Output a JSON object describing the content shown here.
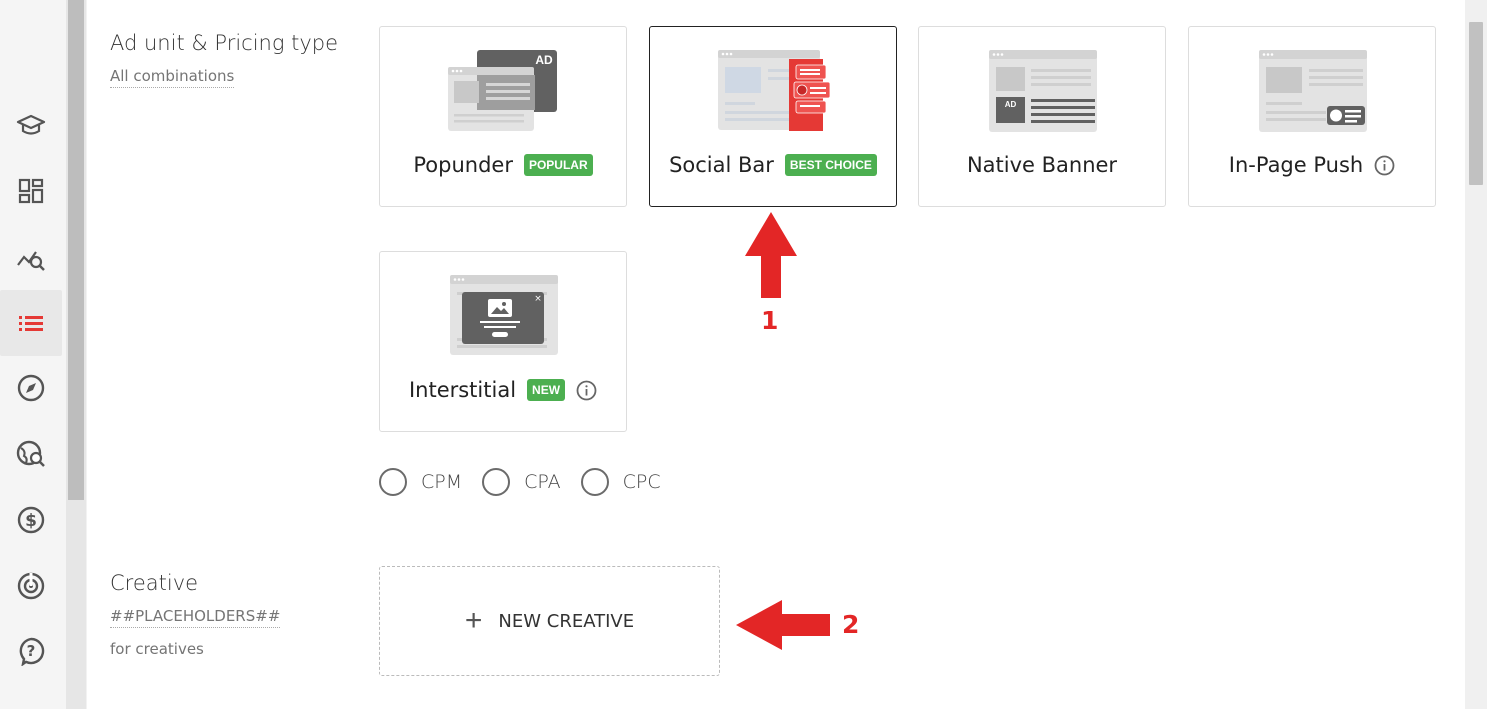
{
  "sidebar": {
    "items": [
      {
        "icon": "graduation-cap-icon"
      },
      {
        "icon": "dashboard-icon"
      },
      {
        "icon": "analytics-search-icon"
      },
      {
        "icon": "list-icon",
        "active": true
      },
      {
        "icon": "compass-icon"
      },
      {
        "icon": "globe-search-icon"
      },
      {
        "icon": "dollar-icon"
      },
      {
        "icon": "radar-icon"
      },
      {
        "icon": "help-icon"
      }
    ],
    "active_color": "#e53935"
  },
  "ad_unit": {
    "title": "Ad unit & Pricing type",
    "subtitle": "All combinations",
    "cards": [
      {
        "title": "Popunder",
        "badge": "POPULAR"
      },
      {
        "title": "Social Bar",
        "badge": "BEST CHOICE",
        "selected": true
      },
      {
        "title": "Native Banner"
      },
      {
        "title": "In-Page Push",
        "info": true
      },
      {
        "title": "Interstitial",
        "badge": "NEW",
        "info": true
      }
    ],
    "pricing": [
      "CPM",
      "CPA",
      "CPC"
    ]
  },
  "creative": {
    "title": "Creative",
    "placeholder_link": "##PLACEHOLDERS##",
    "subtitle": "for creatives",
    "new_button": "NEW CREATIVE"
  },
  "annotations": {
    "arrow1_label": "1",
    "arrow2_label": "2",
    "color": "#e32626"
  },
  "badge_color": "#4caf50"
}
